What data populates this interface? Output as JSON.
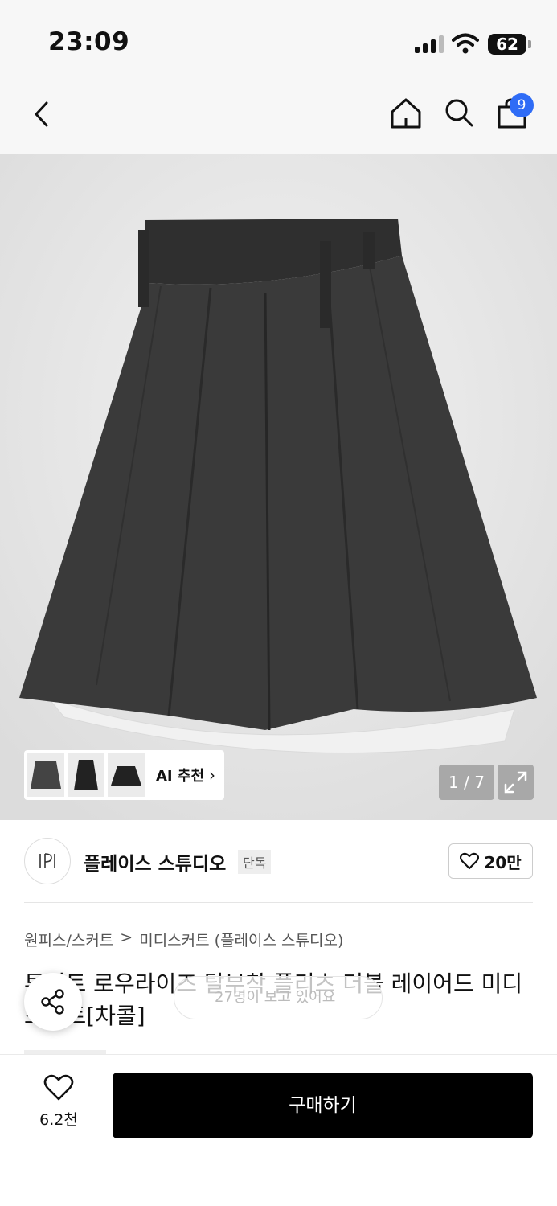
{
  "status": {
    "time": "23:09",
    "battery": "62"
  },
  "nav": {
    "cart_count": "9"
  },
  "gallery": {
    "ai_label": "AI 추천",
    "counter": "1 / 7"
  },
  "brand": {
    "logo_text": "PLACE STUDIO",
    "name": "플레이스 스튜디오",
    "tag": "단독",
    "likes": "20만"
  },
  "product": {
    "breadcrumb": [
      "원피스/스커트",
      "미디스커트 (플레이스 스튜디오)"
    ],
    "breadcrumb_sep": ">",
    "title": "투턱트 로우라이즈 탈부착 플리츠 더블 레이어드 미디스커트[차콜]",
    "viewers": "27명이 보고 있어요"
  },
  "footer": {
    "wish_count": "6.2천",
    "buy_label": "구매하기"
  },
  "colors": {
    "badge": "#2f6cf6",
    "buy_button": "#000000",
    "skirt": "#3a3a3a"
  },
  "icons": [
    "back-icon",
    "home-icon",
    "search-icon",
    "bag-icon",
    "chevron-right-icon",
    "expand-icon",
    "heart-icon",
    "share-icon"
  ]
}
